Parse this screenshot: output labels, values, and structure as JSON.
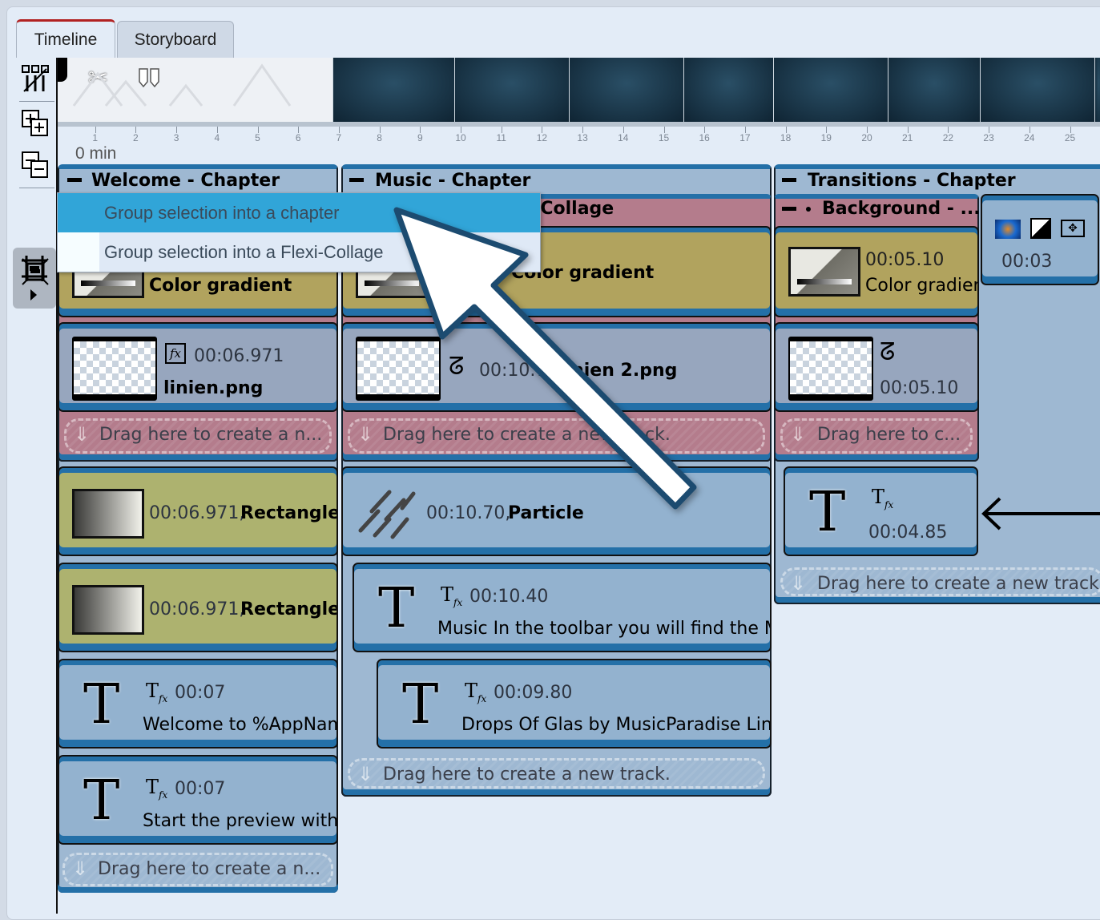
{
  "tabs": [
    {
      "label": "Timeline",
      "active": true
    },
    {
      "label": "Storyboard",
      "active": false
    }
  ],
  "toolbar": {
    "icons": [
      "remove-cuts-icon",
      "add-chapter-icon",
      "remove-chapter-icon",
      "group-selection-icon",
      "ungroup-icon"
    ]
  },
  "preview_strip": {
    "icons": [
      "scissors-icon",
      "split-marker-icon"
    ]
  },
  "ruler": {
    "ticks": [
      "1",
      "2",
      "3",
      "4",
      "5",
      "6",
      "7",
      "8",
      "9",
      "10",
      "11",
      "12",
      "13",
      "14",
      "15",
      "16",
      "17",
      "18",
      "19",
      "20",
      "21",
      "22",
      "23",
      "24",
      "25"
    ],
    "start_label": "0 min"
  },
  "context_menu": {
    "items": [
      "Group selection into a chapter",
      "Group selection into a Flexi-Collage"
    ],
    "highlighted": 0
  },
  "chapters": {
    "welcome": {
      "title": "Welcome - Chapter",
      "color_gradient": "Color gradient",
      "image": {
        "time": "00:06.971",
        "name": "linien.png"
      },
      "drag": "Drag here to create a n...",
      "rect1": {
        "time": "00:06.971,",
        "name": "Rectangle"
      },
      "rect2": {
        "time": "00:06.971,",
        "name": "Rectangle"
      },
      "text1": {
        "time": "00:07",
        "name": "Welcome to %AppName%"
      },
      "text2": {
        "time": "00:07",
        "name": "Start the preview with"
      },
      "drag2": "Drag here to create a n..."
    },
    "music": {
      "title": "Music - Chapter",
      "flexi": "Flexi-Collage",
      "color_gradient": "Color gradient",
      "image": {
        "time": "00:10.70",
        "name": "linien 2.png"
      },
      "drag": "Drag here to create a new track.",
      "particle": {
        "time": "00:10.70,",
        "name": "Particle"
      },
      "text1": {
        "time": "00:10.40",
        "name": "Music In the toolbar you will find the Music"
      },
      "text2": {
        "time": "00:09.80",
        "name": "Drops Of Glas by MusicParadise Link"
      },
      "drag2": "Drag here to create a new track."
    },
    "transitions": {
      "title": "Transitions - Chapter",
      "background": "Background - ...",
      "color_gradient": {
        "time": "00:05.10",
        "name": "Color gradient"
      },
      "image": {
        "time": "00:05.10"
      },
      "drag": "Drag here to c...",
      "transition": {
        "time": "00:03"
      },
      "text": {
        "time": "00:04.85"
      },
      "drag2": "Drag here to create a new track."
    }
  },
  "colors": {
    "accent_blue": "#2470a8",
    "menu_highlight": "#31a5d8",
    "background_track": "#b47c8c",
    "active_tab": "#b22222"
  }
}
